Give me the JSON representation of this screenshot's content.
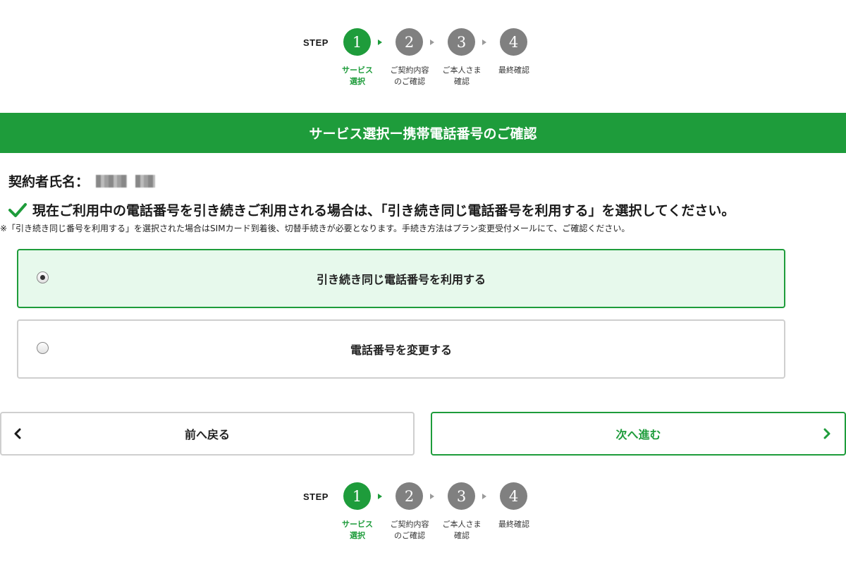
{
  "stepper": {
    "step_word": "STEP",
    "steps": [
      {
        "number": "1",
        "label": "サービス\n選択",
        "active": true
      },
      {
        "number": "2",
        "label": "ご契約内容\nのご確認",
        "active": false
      },
      {
        "number": "3",
        "label": "ご本人さま\n確認",
        "active": false
      },
      {
        "number": "4",
        "label": "最終確認",
        "active": false
      }
    ]
  },
  "banner": {
    "title": "サービス選択ー携帯電話番号のご確認"
  },
  "contract": {
    "label": "契約者氏名："
  },
  "instruction": {
    "text": "現在ご利用中の電話番号を引き続きご利用される場合は、「引き続き同じ電話番号を利用する」を選択してください。",
    "icon": "checkmark-icon"
  },
  "note": {
    "text": "※「引き続き同じ番号を利用する」を選択された場合はSIMカード到着後、切替手続きが必要となります。手続き方法はプラン変更受付メールにて、ご確認ください。"
  },
  "options": [
    {
      "label": "引き続き同じ電話番号を利用する",
      "selected": true
    },
    {
      "label": "電話番号を変更する",
      "selected": false
    }
  ],
  "nav": {
    "back_label": "前へ戻る",
    "next_label": "次へ進む"
  },
  "colors": {
    "accent": "#1e9c3b",
    "selected_bg": "#e7f9ec",
    "inactive_step": "#808080"
  }
}
